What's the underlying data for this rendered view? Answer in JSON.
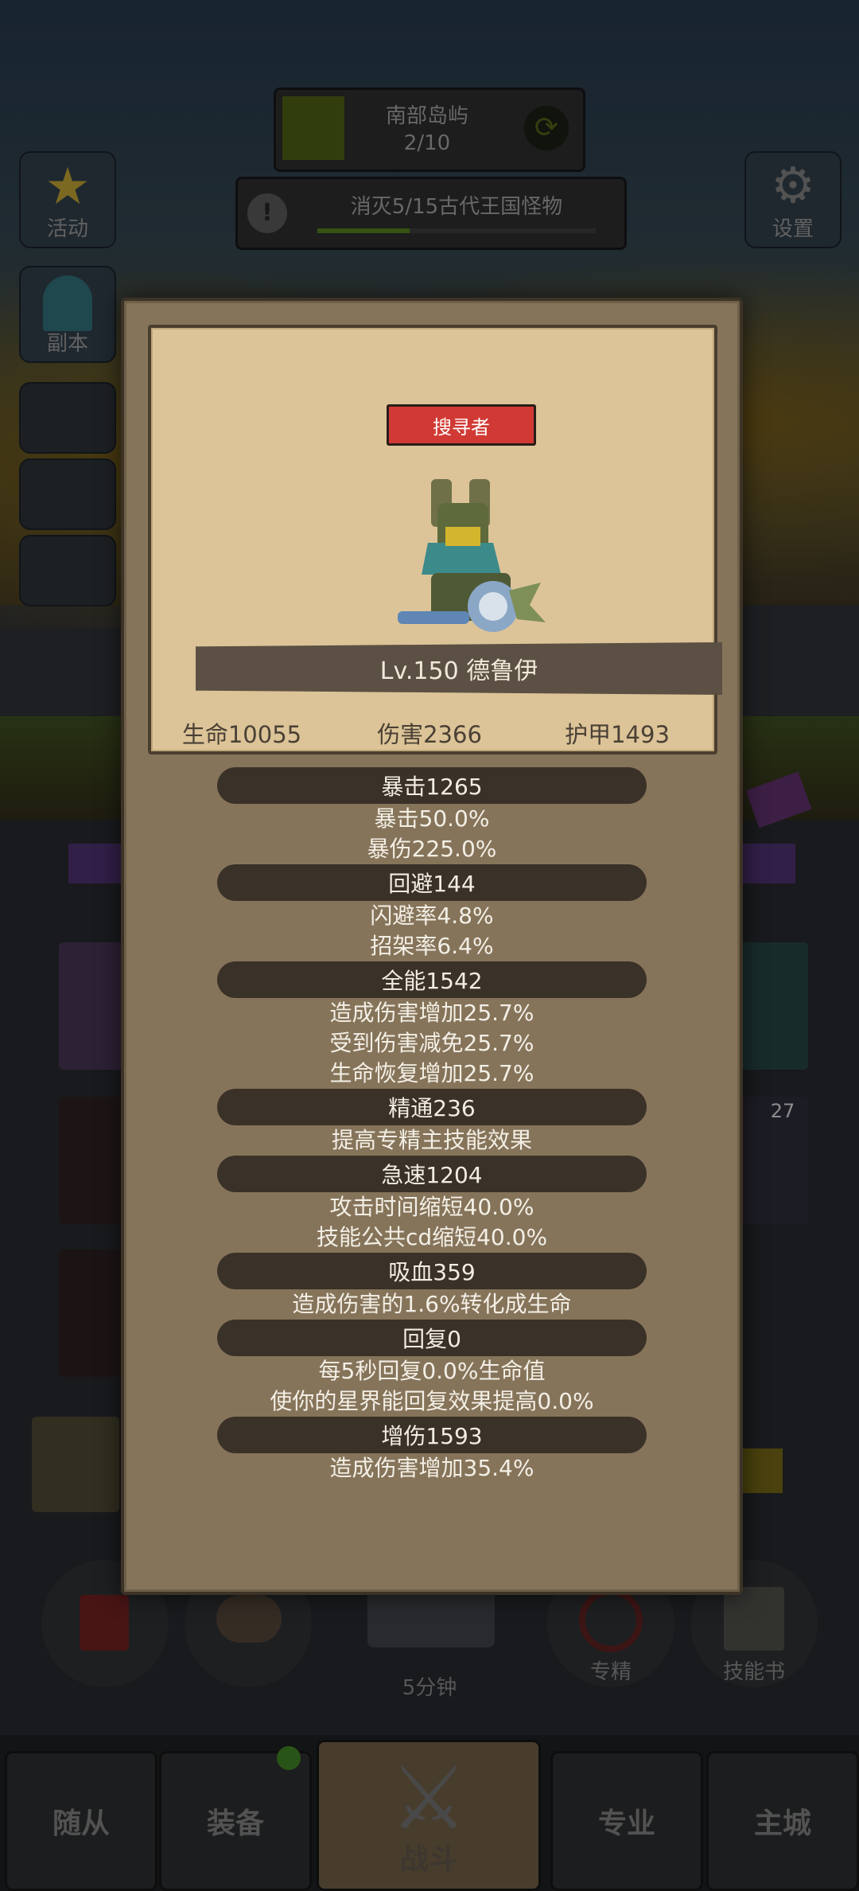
{
  "hud": {
    "region_name": "南部岛屿",
    "region_progress": "2/10",
    "quest_text": "消灭5/15古代王国怪物",
    "quest_progress": 0.33
  },
  "side_buttons": {
    "activity": "活动",
    "dungeon": "副本",
    "settings": "设置"
  },
  "background_labels": {
    "timer": "5分钟",
    "specialize": "专精",
    "skillbook": "技能书",
    "badge_count": "27"
  },
  "bottom_nav": {
    "followers": "随从",
    "equipment": "装备",
    "battle": "战斗",
    "profession": "专业",
    "main_city": "主城"
  },
  "hero": {
    "class_label": "搜寻者",
    "title": "Lv.150 德鲁伊",
    "hp": "生命10055",
    "damage": "伤害2366",
    "armor": "护甲1493"
  },
  "stats": [
    {
      "header": "暴击1265",
      "lines": [
        "暴击50.0%",
        "暴伤225.0%"
      ]
    },
    {
      "header": "回避144",
      "lines": [
        "闪避率4.8%",
        "招架率6.4%"
      ]
    },
    {
      "header": "全能1542",
      "lines": [
        "造成伤害增加25.7%",
        "受到伤害减免25.7%",
        "生命恢复增加25.7%"
      ]
    },
    {
      "header": "精通236",
      "lines": [
        "提高专精主技能效果"
      ]
    },
    {
      "header": "急速1204",
      "lines": [
        "攻击时间缩短40.0%",
        "技能公共cd缩短40.0%"
      ]
    },
    {
      "header": "吸血359",
      "lines": [
        "造成伤害的1.6%转化成生命"
      ]
    },
    {
      "header": "回复0",
      "lines": [
        "每5秒回复0.0%生命值",
        "使你的星界能回复效果提高0.0%"
      ]
    },
    {
      "header": "增伤1593",
      "lines": [
        "造成伤害增加35.4%"
      ]
    }
  ],
  "colors": {
    "modal_bg": "#86745a",
    "card_bg": "#dcc498",
    "class_badge": "#d13a34",
    "stat_header_bg": "#3a3128"
  }
}
